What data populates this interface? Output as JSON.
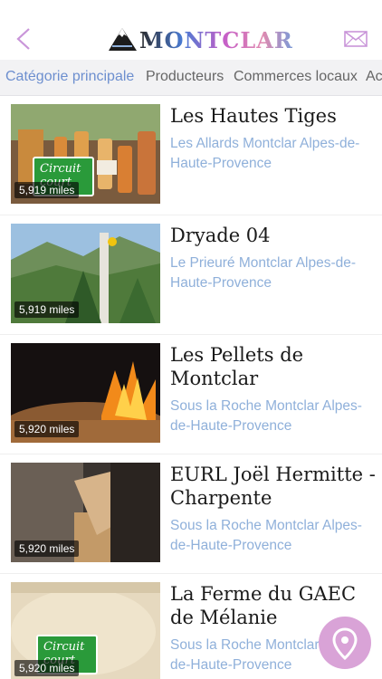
{
  "header": {
    "logo_text": "MONTCLAR",
    "back_icon": "chevron-left-icon",
    "mail_icon": "mail-icon",
    "accent_color": "#c995d9"
  },
  "tabs": [
    {
      "label": "Catégorie principale",
      "active": true
    },
    {
      "label": "Producteurs",
      "active": false
    },
    {
      "label": "Commerces locaux",
      "active": false
    },
    {
      "label": "Ac",
      "active": false
    }
  ],
  "items": [
    {
      "title": "Les Hautes Tiges",
      "address": "Les Allards Montclar Alpes-de-Haute-Provence",
      "distance": "5,919 miles",
      "badge": "Circuit court"
    },
    {
      "title": "Dryade 04",
      "address": "Le Prieuré Montclar Alpes-de-Haute-Provence",
      "distance": "5,919 miles"
    },
    {
      "title": "Les Pellets de Montclar",
      "address": "Sous la Roche Montclar Alpes-de-Haute-Provence",
      "distance": "5,920 miles"
    },
    {
      "title": "EURL Joël Hermitte - Charpente",
      "address": "Sous la Roche Montclar Alpes-de-Haute-Provence",
      "distance": "5,920 miles"
    },
    {
      "title": "La Ferme du GAEC de Mélanie",
      "address": "Sous la Roche Montclar Alpes-de-Haute-Provence",
      "distance": "5,920 miles",
      "badge": "Circuit court"
    }
  ],
  "map_button_icon": "map-pin-icon"
}
